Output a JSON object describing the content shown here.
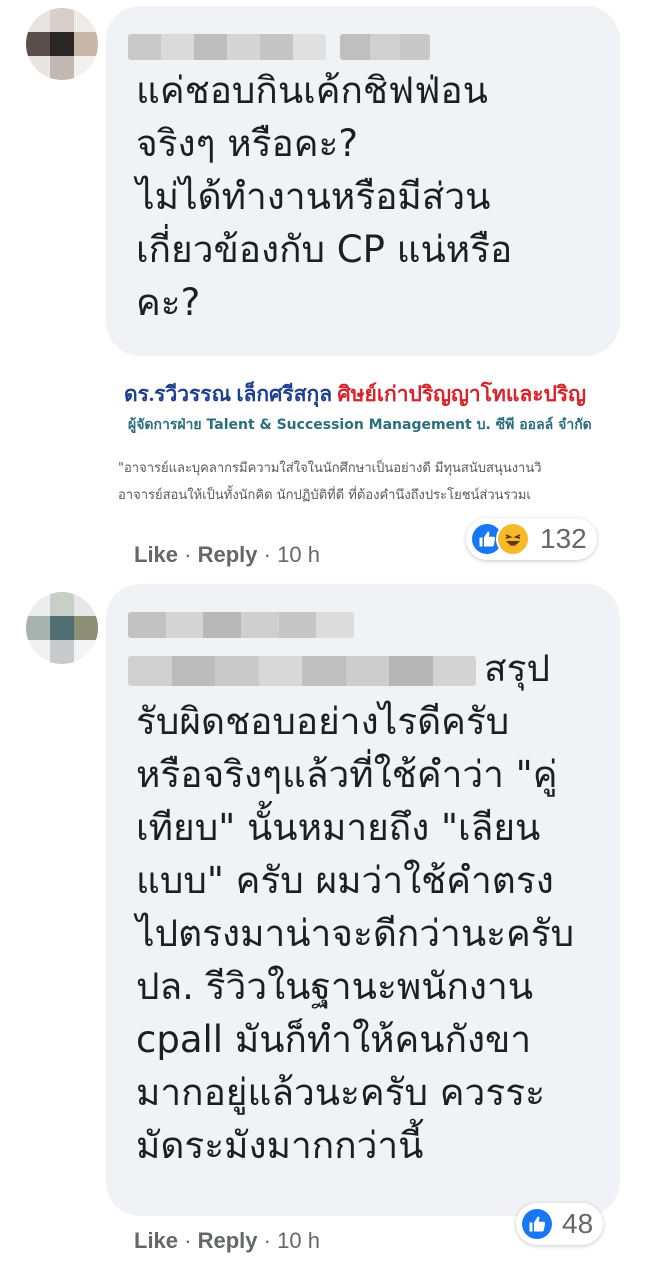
{
  "comments": [
    {
      "text": "แค่ชอบกินเค้กชิฟฟ่อน\nจริงๆ หรือคะ?\nไม่ได้ทำงานหรือมีส่วน\nเกี่ยวข้องกับ CP แน่หรือ\nคะ?",
      "attachment": {
        "line1_name": "ดร.รวีวรรณ เล็กศรีสกุล",
        "line1_title": "ศิษย์เก่าปริญญาโทและปริญ",
        "line2": "ผู้จัดการฝ่าย Talent & Succession Management บ. ซีพี ออลล์ จำกัด",
        "line3": "\"อาจารย์และบุคลากรมีความใส่ใจในนักศึกษาเป็นอย่างดี มีทุนสนับสนุนงานวิ",
        "line4": "อาจารย์สอนให้เป็นทั้งนักคิด นักปฏิบัติที่ดี ที่ต้องคำนึงถึงประโยชน์ส่วนรวมเ"
      },
      "actions": {
        "like": "Like",
        "separator": "·",
        "reply": "Reply",
        "time": "10 h"
      },
      "reactions": {
        "icons": [
          "like-icon",
          "haha-icon"
        ],
        "count": "132"
      }
    },
    {
      "text_suffix": "สรุป",
      "text": "รับผิดชอบอย่างไรดีครับ\nหรือจริงๆแล้วที่ใช้คำว่า \"คู่\nเทียบ\" นั้นหมายถึง \"เลียน\nแบบ\" ครับ ผมว่าใช้คำตรง\nไปตรงมาน่าจะดีกว่านะครับ\nปล. รีวิวในฐานะพนักงาน\ncpall มันก็ทำให้คนกังขา\nมากอยู่แล้วนะครับ ควรระ\nมัดระมังมากกว่านี้",
      "actions": {
        "like": "Like",
        "separator": "·",
        "reply": "Reply",
        "time": "10 h"
      },
      "reactions": {
        "icons": [
          "like-icon"
        ],
        "count": "48"
      }
    }
  ],
  "colors": {
    "bubble": "#f0f2f5",
    "meta": "#65676b",
    "like_blue": "#1877f2",
    "haha_yellow": "#f7b928"
  }
}
